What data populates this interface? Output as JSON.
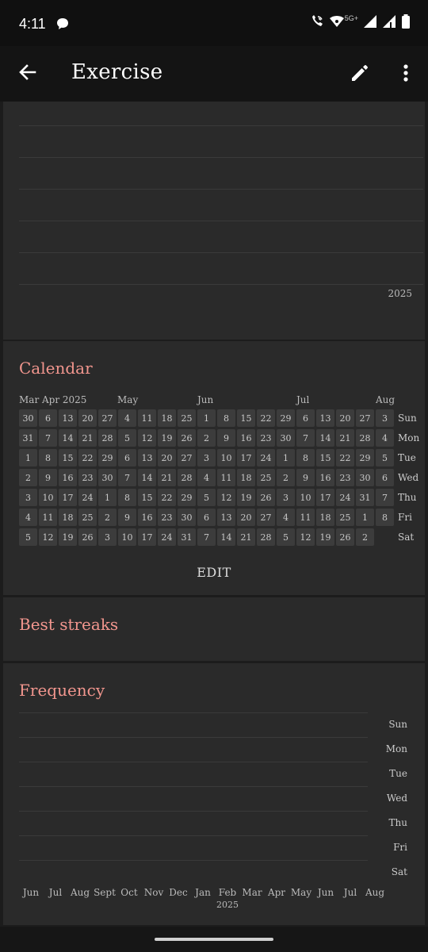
{
  "status_bar": {
    "time": "4:11",
    "network": "5G+",
    "icons": [
      "chat-bubble-icon",
      "wifi-call-icon",
      "wifi-icon",
      "signal-icon",
      "signal-icon",
      "battery-icon"
    ]
  },
  "app_bar": {
    "title": "Exercise",
    "back_icon": "arrow-back-icon",
    "edit_icon": "pencil-icon",
    "more_icon": "more-vertical-icon"
  },
  "history_chart": {
    "year_label": "2025"
  },
  "calendar": {
    "title": "Calendar",
    "edit_label": "EDIT",
    "month_labels": [
      "Mar Apr 2025",
      "May",
      "Jun",
      "Jul",
      "Aug"
    ],
    "weekday_labels": [
      "Sun",
      "Mon",
      "Tue",
      "Wed",
      "Thu",
      "Fri",
      "Sat"
    ],
    "weeks": [
      [
        "30",
        "31",
        "1",
        "2",
        "3",
        "4",
        "5"
      ],
      [
        "6",
        "7",
        "8",
        "9",
        "10",
        "11",
        "12"
      ],
      [
        "13",
        "14",
        "15",
        "16",
        "17",
        "18",
        "19"
      ],
      [
        "20",
        "21",
        "22",
        "23",
        "24",
        "25",
        "26"
      ],
      [
        "27",
        "28",
        "29",
        "30",
        "1",
        "2",
        "3"
      ],
      [
        "4",
        "5",
        "6",
        "7",
        "8",
        "9",
        "10"
      ],
      [
        "11",
        "12",
        "13",
        "14",
        "15",
        "16",
        "17"
      ],
      [
        "18",
        "19",
        "20",
        "21",
        "22",
        "23",
        "24"
      ],
      [
        "25",
        "26",
        "27",
        "28",
        "29",
        "30",
        "31"
      ],
      [
        "1",
        "2",
        "3",
        "4",
        "5",
        "6",
        "7"
      ],
      [
        "8",
        "9",
        "10",
        "11",
        "12",
        "13",
        "14"
      ],
      [
        "15",
        "16",
        "17",
        "18",
        "19",
        "20",
        "21"
      ],
      [
        "22",
        "23",
        "24",
        "25",
        "26",
        "27",
        "28"
      ],
      [
        "29",
        "30",
        "1",
        "2",
        "3",
        "4",
        "5"
      ],
      [
        "6",
        "7",
        "8",
        "9",
        "10",
        "11",
        "12"
      ],
      [
        "13",
        "14",
        "15",
        "16",
        "17",
        "18",
        "19"
      ],
      [
        "20",
        "21",
        "22",
        "23",
        "24",
        "25",
        "26"
      ],
      [
        "27",
        "28",
        "29",
        "30",
        "31",
        "1",
        "2"
      ],
      [
        "3",
        "4",
        "5",
        "6",
        "7",
        "8"
      ]
    ]
  },
  "best_streaks": {
    "title": "Best streaks"
  },
  "frequency": {
    "title": "Frequency",
    "weekday_labels": [
      "Sun",
      "Mon",
      "Tue",
      "Wed",
      "Thu",
      "Fri",
      "Sat"
    ],
    "month_labels": [
      "Jun",
      "Jul",
      "Aug",
      "Sept",
      "Oct",
      "Nov",
      "Dec",
      "Jan",
      "Feb",
      "Mar",
      "Apr",
      "May",
      "Jun",
      "Jul",
      "Aug"
    ],
    "year_label": "2025"
  },
  "colors": {
    "accent": "#f2968e",
    "card": "#2a2a2a",
    "cell": "#3c3c3c",
    "background": "#1c1c1c"
  }
}
